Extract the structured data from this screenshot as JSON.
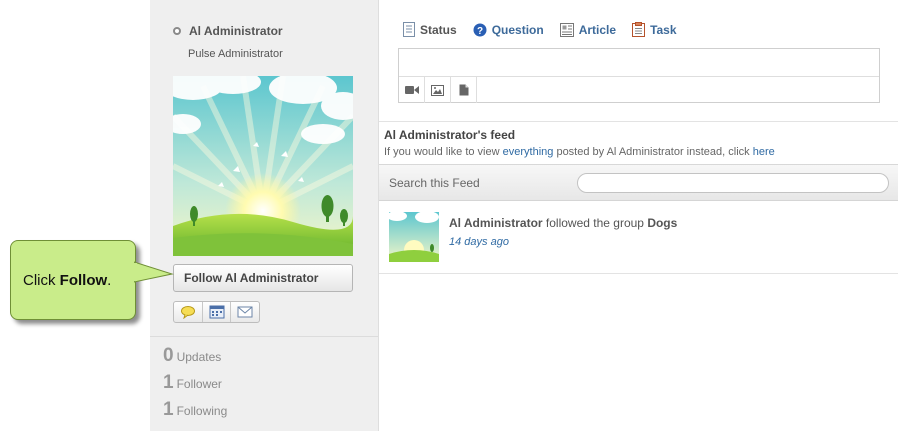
{
  "profile": {
    "name": "Al Administrator",
    "title": "Pulse Administrator",
    "follow_button": "Follow Al Administrator",
    "action_icons": [
      "speech-bubble-icon",
      "calendar-icon",
      "envelope-icon"
    ],
    "stats": [
      {
        "count": "0",
        "label": "Updates"
      },
      {
        "count": "1",
        "label": "Follower"
      },
      {
        "count": "1",
        "label": "Following"
      }
    ]
  },
  "callout": {
    "prefix": "Click ",
    "bold": "Follow",
    "suffix": "."
  },
  "composer": {
    "tabs": [
      {
        "label": "Status",
        "icon": "document-icon",
        "active": true
      },
      {
        "label": "Question",
        "icon": "question-icon",
        "active": false
      },
      {
        "label": "Article",
        "icon": "article-icon",
        "active": false
      },
      {
        "label": "Task",
        "icon": "clipboard-icon",
        "active": false
      }
    ],
    "attachments": [
      "video-icon",
      "image-icon",
      "file-icon"
    ]
  },
  "feed": {
    "title": "Al Administrator's feed",
    "subtitle_prefix": "If you would like to view ",
    "subtitle_link": "everything",
    "subtitle_middle": " posted by Al Administrator instead, click ",
    "subtitle_link2": "here",
    "search_label": "Search this Feed",
    "search_value": "",
    "items": [
      {
        "actor": "Al Administrator",
        "action": " followed the group ",
        "object": "Dogs",
        "time": "14 days ago"
      }
    ]
  },
  "colors": {
    "link": "#2f6aa3",
    "callout_bg": "#c9ec8a",
    "sidebar_bg": "#efefef"
  }
}
